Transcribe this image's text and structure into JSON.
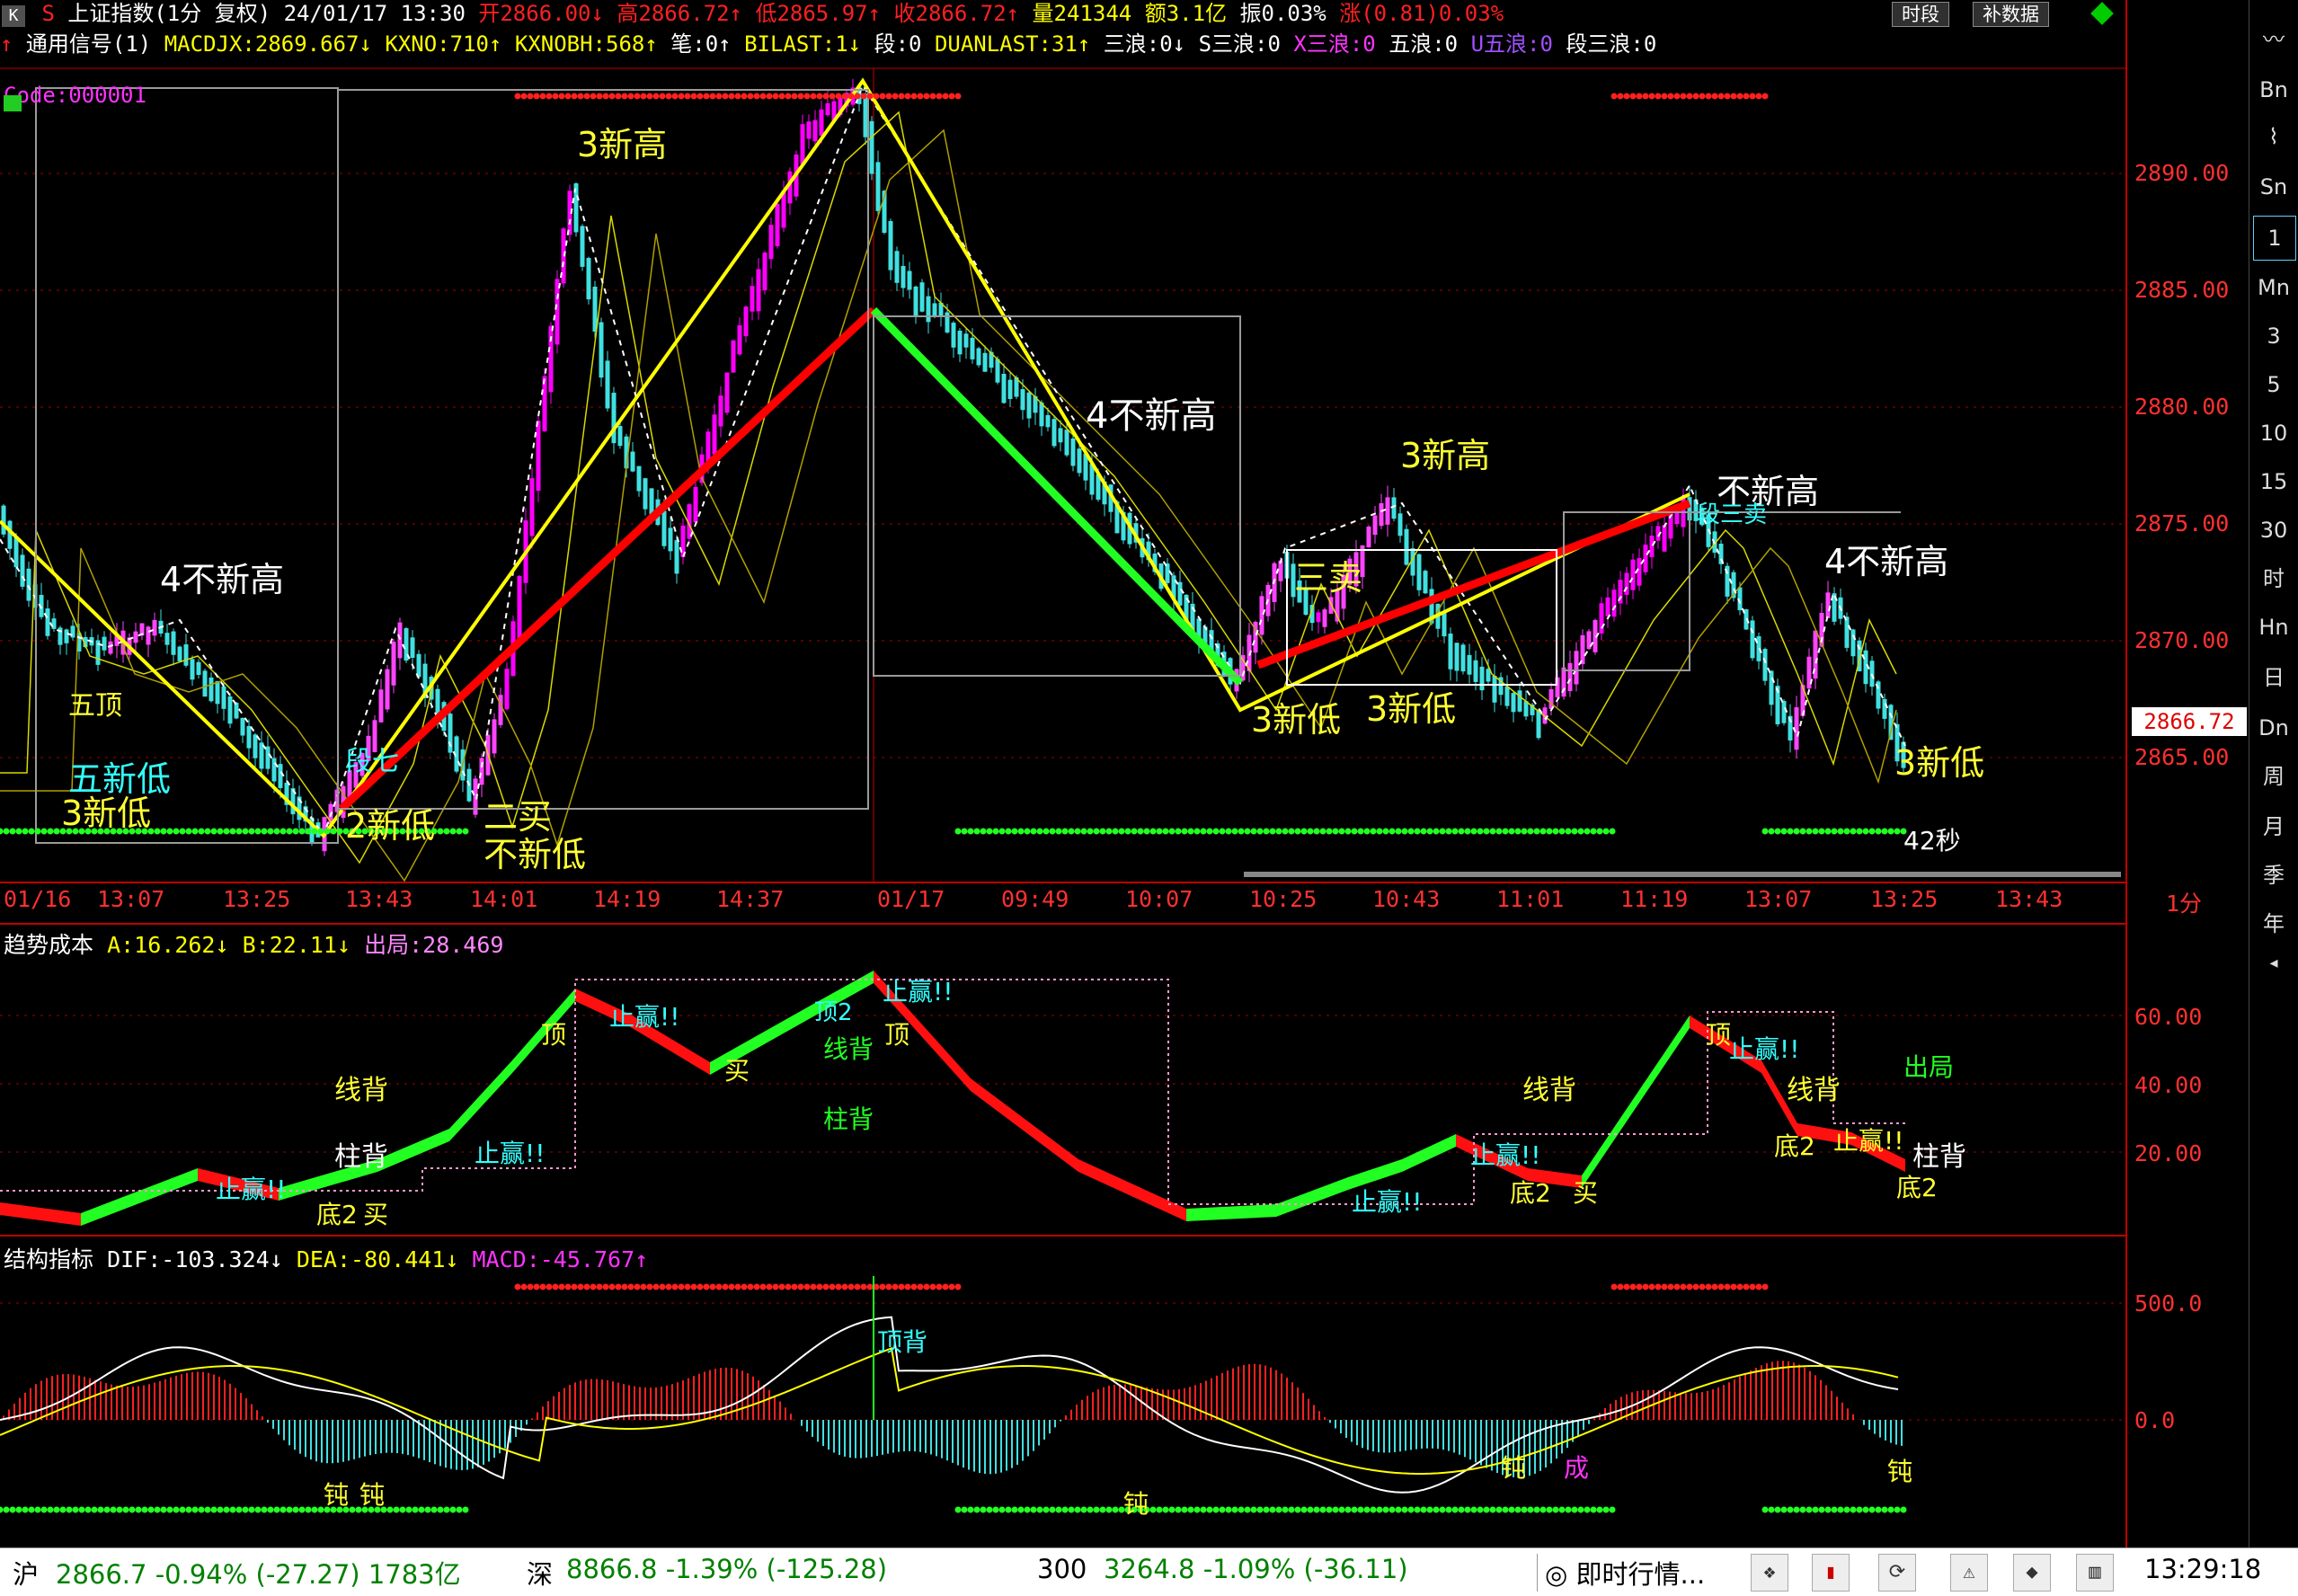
{
  "title_bar": {
    "menu_glyph": "K",
    "code_glyph": "S",
    "symbol": "上证指数(1分 复权)",
    "datetime": "24/01/17 13:30",
    "open": "开2866.00↓",
    "high": "高2866.72↑",
    "low": "低2865.97↑",
    "close": "收2866.72↑",
    "volume": "量241344",
    "amount": "额3.1亿",
    "amplitude": "振0.03%",
    "change": "涨(0.81)0.03%",
    "btn_period": "时段",
    "btn_data": "补数据"
  },
  "signal_line": {
    "arrow": "↑",
    "name": "通用信号(1)",
    "macdjx": "MACDJX:2869.667↓",
    "kxno": "KXNO:710↑",
    "kxnobh": "KXNOBH:568↑",
    "bi": "笔:0↑",
    "bilast": "BILAST:1↓",
    "duan": "段:0",
    "duanlast": "DUANLAST:31↑",
    "sanlang": "三浪:0↓",
    "s_sanlang": "S三浪:0",
    "x_sanlang": "X三浪:0",
    "wulang": "五浪:0",
    "u_wulang": "U五浪:0",
    "duan_sanlang": "段三浪:0"
  },
  "main_chart": {
    "code_label": "Code:000001",
    "y_ticks": [
      "2890.00",
      "2885.00",
      "2880.00",
      "2875.00",
      "2870.00",
      "2865.00"
    ],
    "current_price": "2866.72",
    "x_ticks": [
      "01/16",
      "13:07",
      "13:25",
      "13:43",
      "14:01",
      "14:19",
      "14:37",
      "01/17",
      "09:49",
      "10:07",
      "10:25",
      "10:43",
      "11:01",
      "11:19",
      "13:07",
      "13:25",
      "13:43"
    ],
    "period_label": "1分",
    "countdown": "42秒",
    "annotations": {
      "a1": "4不新高",
      "a2": "五新低",
      "a3": "3新低",
      "a4": "3新高",
      "a5": "段七",
      "a6": "2新低",
      "a7": "二买",
      "a8": "不新低",
      "a9": "4不新高",
      "a10": "3新高",
      "a11": "3新低",
      "a12": "3新低",
      "a13": "不新高",
      "a14": "段三卖",
      "a15": "4不新高",
      "a16": "3新低",
      "a17": "三卖",
      "a18": "五顶"
    }
  },
  "trend_panel": {
    "name": "趋势成本",
    "a": "A:16.262↓",
    "b": "B:22.11↓",
    "exit": "出局:28.469",
    "y_ticks": [
      "60.00",
      "40.00",
      "20.00"
    ],
    "labels": {
      "l1": "线背",
      "l2": "柱背",
      "l3": "止赢!!",
      "l4": "底2",
      "l5": "买",
      "l6": "止赢!!",
      "l7": "顶",
      "l8": "止赢!!",
      "l9": "买",
      "l10": "顶2",
      "l11": "线背",
      "l12": "顶",
      "l13": "止赢!!",
      "l14": "柱背",
      "l15": "线背",
      "l16": "止赢!!",
      "l17": "底2",
      "l18": "买",
      "l19": "顶",
      "l20": "止赢!!",
      "l21": "线背",
      "l22": "底2",
      "l23": "止赢!!",
      "l24": "柱背",
      "l25": "底2",
      "l26": "出局",
      "l27": "止赢!!"
    }
  },
  "macd_panel": {
    "name": "结构指标",
    "dif": "DIF:-103.324↓",
    "dea": "DEA:-80.441↓",
    "macd": "MACD:-45.767↑",
    "y_ticks": [
      "500.0",
      "0.0"
    ],
    "labels": {
      "m1": "顶背",
      "m2": "钝",
      "m3": "钝",
      "m4": "钝",
      "m5": "成",
      "m6": "钝",
      "m7": "钝"
    }
  },
  "right_toolbar": [
    "Bn",
    "Sn",
    "1",
    "Mn",
    "3",
    "5",
    "10",
    "15",
    "30",
    "时",
    "Hn",
    "日",
    "Dn",
    "周",
    "月",
    "季",
    "年"
  ],
  "status_bar": {
    "sh_label": "沪",
    "sh_value": "2866.7 -0.94% (-27.27) 1783亿",
    "sz_label": "深",
    "sz_value": "8866.8 -1.39% (-125.28)",
    "hs300_label": "300",
    "hs300_value": "3264.8 -1.09% (-36.11)",
    "news": "即时行情...",
    "time": "13:29:18"
  },
  "colors": {
    "up": "#ff2020",
    "down": "#40e0e0",
    "yellow": "#ffff00",
    "magenta": "#ff00ff",
    "green": "#00ff00",
    "grid": "#a00000"
  }
}
